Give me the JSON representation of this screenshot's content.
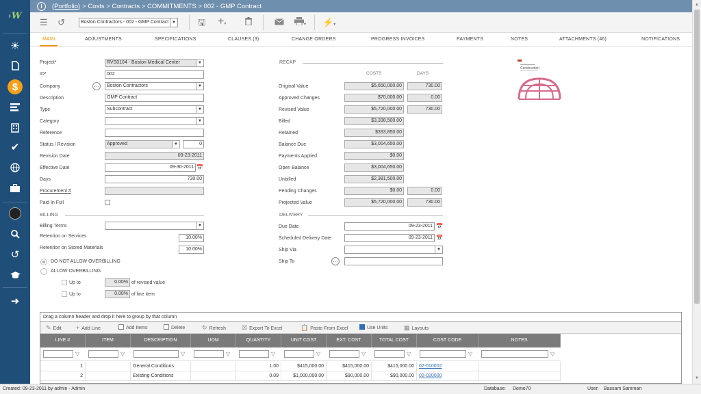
{
  "app": {
    "logo_glyph": "W"
  },
  "breadcrumb": {
    "portfolio": "(Portfolio)",
    "trail": "> Costs > Contracts > COMMITMENTS > 002 - GMP Contract"
  },
  "toolbar": {
    "record_select": "Boston Contractors - 002 - GMP Contract"
  },
  "tabs": [
    "MAIN",
    "ADJUSTMENTS",
    "SPECIFICATIONS",
    "CLAUSES (3)",
    "CHANGE ORDERS",
    "PROGRESS INVOICES",
    "PAYMENTS",
    "NOTES",
    "ATTACHMENTS (46)",
    "NOTIFICATIONS"
  ],
  "left": {
    "project_label": "Project*",
    "project": "RVS0104 - Boston Medical Center",
    "id_label": "ID*",
    "id": "002",
    "company_label": "Company",
    "company": "Boston Contractors",
    "description_label": "Description",
    "description": "GMP Contract",
    "type_label": "Type",
    "type": "Subcontract",
    "category_label": "Category",
    "category": "",
    "reference_label": "Reference",
    "reference": "",
    "status_label": "Status / Revision",
    "status": "Approved",
    "revision": "0",
    "revision_date_label": "Revision Date",
    "revision_date": "09-23-2011",
    "effective_date_label": "Effective Date",
    "effective_date": "09-30-2011",
    "days_label": "Days",
    "days": "730.00",
    "procurement_label": "Procurement #",
    "procurement": "",
    "paid_label": "Paid In Full"
  },
  "billing": {
    "section": "BILLING",
    "terms_label": "Billing Terms",
    "terms": "",
    "ret_services_label": "Retention on Services",
    "ret_services": "10.00%",
    "ret_materials_label": "Retention on Stored Materials",
    "ret_materials": "10.00%",
    "no_overbill": "DO NOT ALLOW OVERBILLING",
    "allow_overbill": "ALLOW OVERBILLING",
    "upto1_label": "Up to",
    "upto1": "0.00%",
    "upto1_suffix": "of revised value",
    "upto2_label": "Up to",
    "upto2": "0.00%",
    "upto2_suffix": "of line item"
  },
  "recap": {
    "section": "RECAP",
    "costs_col": "COSTS",
    "days_col": "DAYS",
    "rows": [
      {
        "label": "Original Value",
        "cost": "$5,650,000.00",
        "days": "730.00"
      },
      {
        "label": "Approved Changes",
        "cost": "$70,000.00",
        "days": "0.00"
      },
      {
        "label": "Revised Value",
        "cost": "$5,720,000.00",
        "days": "730.00"
      },
      {
        "label": "Billed",
        "cost": "$3,338,500.00",
        "days": ""
      },
      {
        "label": "Retained",
        "cost": "$333,850.00",
        "days": ""
      },
      {
        "label": "Balance Due",
        "cost": "$3,004,650.00",
        "days": ""
      },
      {
        "label": "Payments Applied",
        "cost": "$0.00",
        "days": ""
      },
      {
        "label": "Open Balance",
        "cost": "$3,004,650.00",
        "days": ""
      },
      {
        "label": "Unbilled",
        "cost": "$2,381,500.00",
        "days": ""
      },
      {
        "label": "Pending Changes",
        "cost": "$0.00",
        "days": "0.00"
      },
      {
        "label": "Projected Value",
        "cost": "$5,720,000.00",
        "days": "730.00"
      }
    ]
  },
  "delivery": {
    "section": "DELIVERY",
    "due_label": "Due Date",
    "due": "09-23-2011",
    "sched_label": "Scheduled Delivery Date",
    "sched": "09-23-2011",
    "via_label": "Ship Via",
    "via": "",
    "to_label": "Ship To",
    "to": ""
  },
  "thumbnail": {
    "caption": "Construction"
  },
  "grid": {
    "group_hint": "Drag a column header and drop it here to group by that column",
    "buttons": {
      "edit": "Edit",
      "add_line": "Add Line",
      "add_items": "Add Items",
      "delete": "Delete",
      "refresh": "Refresh",
      "export": "Export To Excel",
      "paste": "Paste From Excel",
      "use_units": "Use Units",
      "layouts": "Layouts"
    },
    "columns": [
      "LINE #",
      "ITEM",
      "DESCRIPTION",
      "UOM",
      "QUANTITY",
      "UNIT COST",
      "EXT. COST",
      "TOTAL COST",
      "COST CODE",
      "NOTES"
    ],
    "rows": [
      {
        "line": "1",
        "item": "",
        "description": "General Conditions",
        "uom": "",
        "quantity": "1.00",
        "unit_cost": "$415,000.00",
        "ext_cost": "$415,000.00",
        "total_cost": "$415,000.00",
        "cost_code": "02-010002",
        "notes": ""
      },
      {
        "line": "2",
        "item": "",
        "description": "Existing Conditions",
        "uom": "",
        "quantity": "0.09",
        "unit_cost": "$1,000,000.00",
        "ext_cost": "$90,000.00",
        "total_cost": "$90,000.00",
        "cost_code": "02-020000",
        "notes": ""
      }
    ]
  },
  "status": {
    "created": "Created:  09-23-2011 by admin - Admin",
    "db_label": "Database:",
    "db": "Demo70",
    "user_label": "User:",
    "user": "Bassam Samman"
  },
  "colors": {
    "sidebar": "#1f4e79",
    "titlebar": "#6f8fae",
    "accent": "#f29100",
    "active_icon": "#f6a01a",
    "grid_header": "#7a7a7a"
  }
}
